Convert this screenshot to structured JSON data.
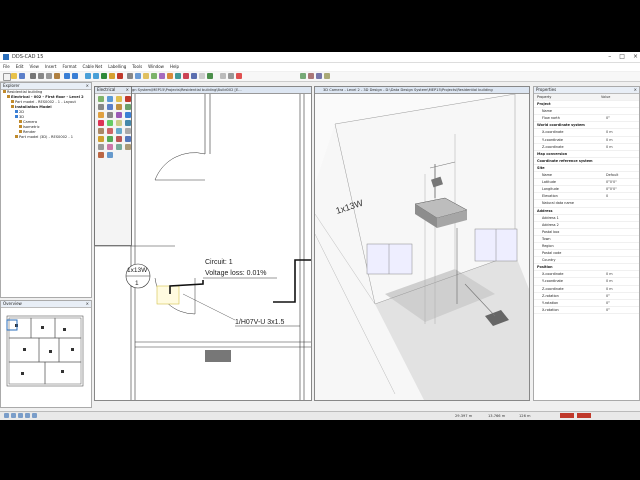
{
  "window": {
    "title": "DDS-CAD 15"
  },
  "menu": [
    "File",
    "Edit",
    "View",
    "Insert",
    "Format",
    "Cable Net",
    "Labelling",
    "Tools",
    "Window",
    "Help"
  ],
  "explorer": {
    "title": "Explorer",
    "items": [
      {
        "label": "Residential building",
        "indent": 0,
        "color": "#c08a2b"
      },
      {
        "label": "Electrical - 002 - First floor - Level 2",
        "indent": 1,
        "color": "#c08a2b",
        "bold": true
      },
      {
        "label": "Part model - RES0002 - 1 - Layout",
        "indent": 2,
        "color": "#c08a2b"
      },
      {
        "label": "Installation Model",
        "indent": 2,
        "color": "#c08a2b",
        "bold": true
      },
      {
        "label": "2D",
        "indent": 3,
        "color": "#3a7fd5"
      },
      {
        "label": "3D",
        "indent": 3,
        "color": "#3a7fd5"
      },
      {
        "label": "Camera",
        "indent": 4,
        "color": "#c08a2b"
      },
      {
        "label": "Isometric",
        "indent": 4,
        "color": "#c08a2b"
      },
      {
        "label": "Render",
        "indent": 4,
        "color": "#c08a2b"
      },
      {
        "label": "Part model (3D) - RES0002 - 1",
        "indent": 3,
        "color": "#c08a2b"
      }
    ]
  },
  "overview": {
    "title": "Overview"
  },
  "electrical_toolbar": {
    "title": "Electrical"
  },
  "view2d": {
    "tab": "2D  D:\\Data Design System\\MEP15\\Projects\\Residential building\\Build002 [E...",
    "symbol_label": "1x13W",
    "symbol_number": "1",
    "circuit": "Circuit: 1",
    "voltage_loss": "Voltage loss: 0.01%",
    "cable": "1/H07V-U 3x1.5"
  },
  "view3d": {
    "tab": "3D  Camera - Level 2 - 3D Design - D:\\Data Design System\\MEP15\\Projects\\Residential building",
    "label": "1x13W"
  },
  "properties": {
    "title": "Properties",
    "col_property": "Property",
    "col_value": "Value",
    "rows": [
      {
        "k": "Project",
        "v": "",
        "sec": true
      },
      {
        "k": "Name",
        "v": ""
      },
      {
        "k": "Flow north",
        "v": "0°"
      },
      {
        "k": "World coordinate system",
        "v": "",
        "sec": true
      },
      {
        "k": "X-coordinate",
        "v": "0 m"
      },
      {
        "k": "Y-coordinate",
        "v": "0 m"
      },
      {
        "k": "Z-coordinate",
        "v": "0 m"
      },
      {
        "k": "Map conversion",
        "v": "",
        "sec": true
      },
      {
        "k": "Coordinate reference system",
        "v": "",
        "sec": true
      },
      {
        "k": "Site",
        "v": "",
        "sec": true
      },
      {
        "k": "Name",
        "v": "Default"
      },
      {
        "k": "Latitude",
        "v": "0°0'0\""
      },
      {
        "k": "Longitude",
        "v": "0°0'0\""
      },
      {
        "k": "Elevation",
        "v": "0"
      },
      {
        "k": "Natural data name",
        "v": ""
      },
      {
        "k": "Address",
        "v": "",
        "sec": true
      },
      {
        "k": "Address 1",
        "v": ""
      },
      {
        "k": "Address 2",
        "v": ""
      },
      {
        "k": "Postal box",
        "v": ""
      },
      {
        "k": "Town",
        "v": ""
      },
      {
        "k": "Region",
        "v": ""
      },
      {
        "k": "Postal code",
        "v": ""
      },
      {
        "k": "Country",
        "v": ""
      },
      {
        "k": "Position",
        "v": "",
        "sec": true
      },
      {
        "k": "X-coordinate",
        "v": "0 m"
      },
      {
        "k": "Y-coordinate",
        "v": "0 m"
      },
      {
        "k": "Z-coordinate",
        "v": "0 m"
      },
      {
        "k": "Z-rotation",
        "v": "0°"
      },
      {
        "k": "Y-rotation",
        "v": "0°"
      },
      {
        "k": "X-rotation",
        "v": "0°"
      }
    ]
  },
  "status": {
    "x": "29.397 m",
    "y": "13.766 m",
    "z": "126 m"
  }
}
